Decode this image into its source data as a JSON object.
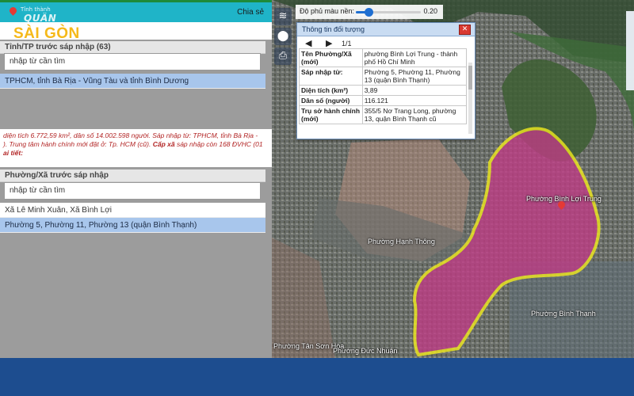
{
  "top_bar": {
    "small_text": "Tỉnh thành",
    "close_label": "Chia sẻ"
  },
  "brand": {
    "top": "QUẬN",
    "main": "SÀI GÒN"
  },
  "province_section": {
    "header": "Tỉnh/TP trước sáp nhập (63)",
    "search_placeholder": "nhập từ cần tìm",
    "items": [
      "TPHCM, tỉnh Bà Rịa - Vũng Tàu và tỉnh Bình Dương"
    ]
  },
  "info": {
    "line1": "diện tích 6.772,59 km², dân số 14.002.598 người. Sáp nhập từ: TPHCM, tỉnh Bà Rịa -",
    "line2": "). Trung tâm hành chính mới đặt ở: Tp. HCM (cũ).",
    "line2_bold": "Cấp xã",
    "line2_tail": "sáp nhập còn 168 ĐVHC (01",
    "line3": "ai tiết:"
  },
  "ward_section": {
    "header": "Phường/Xã trước sáp nhập",
    "search_placeholder": "nhập từ cần tìm",
    "items": [
      {
        "label": "Xã Lê Minh Xuân, Xã Bình Lợi",
        "selected": false
      },
      {
        "label": "Phường 5, Phường 11, Phường 13 (quận Bình Thạnh)",
        "selected": true
      }
    ]
  },
  "opacity": {
    "label": "Độ phủ màu nền:",
    "value": 0.2,
    "value_text": "0.20"
  },
  "popup": {
    "title": "Thông tin đối tượng",
    "page": "1/1",
    "rows": [
      {
        "key": "Tên Phường/Xã (mới)",
        "value": "phường Bình Lợi Trung - thành phố Hồ Chí Minh"
      },
      {
        "key": "Sáp nhập từ:",
        "value": "Phường 5, Phường 11, Phường 13 (quận Bình Thạnh)"
      },
      {
        "key": "Diện tích (km²)",
        "value": "3,89"
      },
      {
        "key": "Dân số (người)",
        "value": "116.121"
      },
      {
        "key": "Trụ sở hành chính (mới)",
        "value": "355/5 Nơ Trang Long, phường 13, quận Bình Thạnh cũ"
      }
    ]
  },
  "map_labels": {
    "ward_marker": "Phường Bình Lợi Trung",
    "hanh_thong": "Phường Hạnh Thông",
    "binh_thanh": "Phường Bình Thạnh",
    "tan_son_hoa": "Phường Tân Sơn Hòa",
    "duc_nhuan": "Phường Đức Nhuận"
  },
  "colors": {
    "accent": "#1fb4c8",
    "brand": "#f5b91a",
    "highlight": "#d1317d",
    "boundary": "#f5ee1d",
    "footer": "#1d4d8f"
  }
}
